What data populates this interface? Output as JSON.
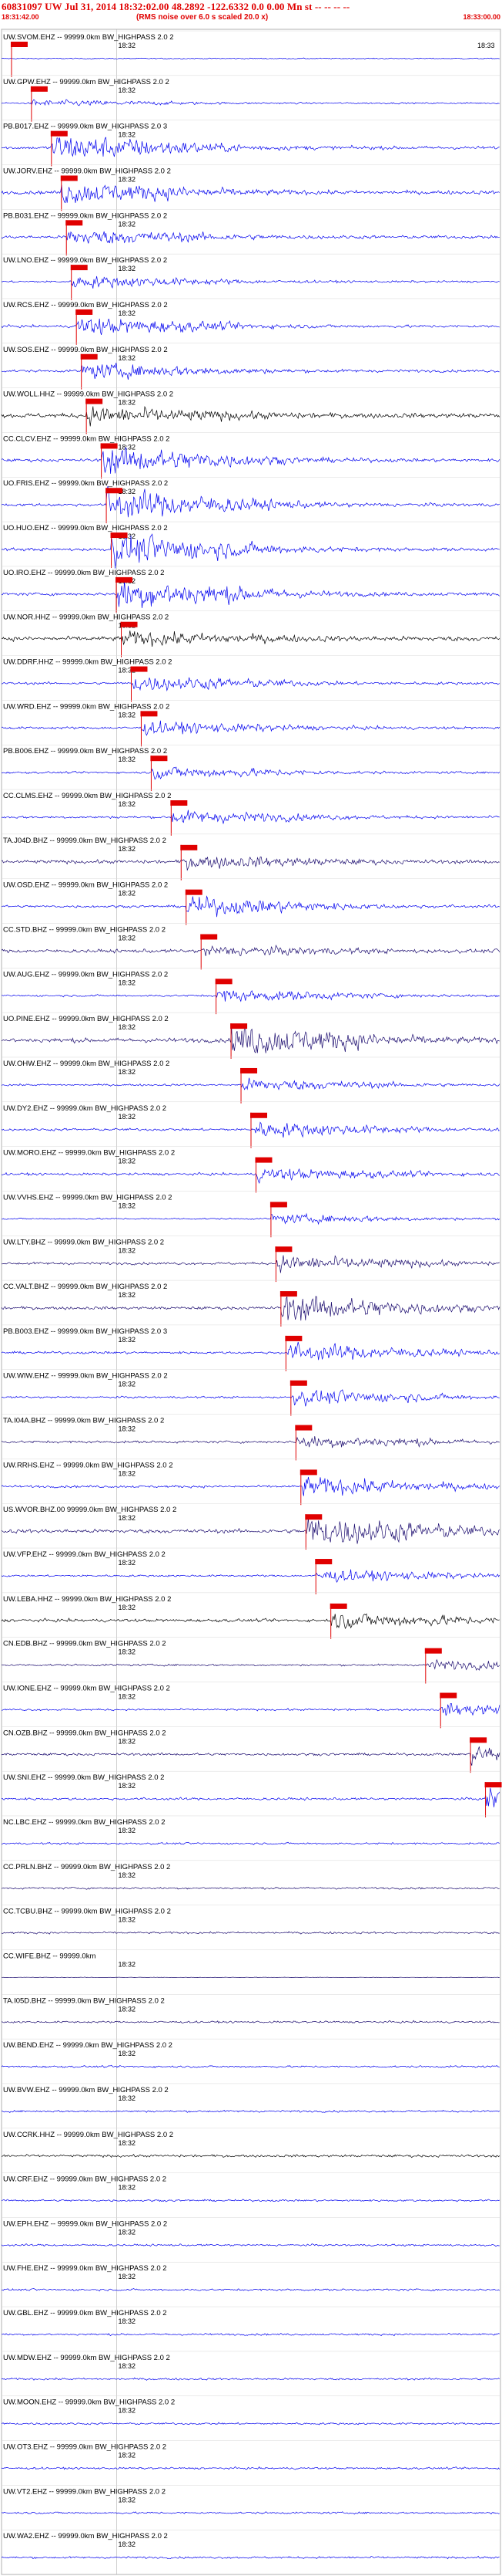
{
  "header": {
    "title": "60831097 UW Jul 31, 2014 18:32:02.00   48.2892 -122.6332   0.0 0.00 Mn st -- -- -- --",
    "subtitle": "(RMS noise over 6.0 s scaled 20.0 x)",
    "start_time": "18:31:42.00",
    "end_time": "18:33:00.00"
  },
  "colors": {
    "title": "#e00000",
    "pick": "#e00000",
    "trace_blue": "#0000ee",
    "trace_black": "#000000",
    "trace_navy": "#1a0a6e",
    "grid": "#b0b0b0"
  },
  "chart_data": {
    "type": "line",
    "title": "60831097 UW Jul 31, 2014 18:32:02.00   48.2892 -122.6332   0.0 0.00 Mn st -- -- -- --",
    "xlabel": "",
    "ylabel": "",
    "x_range": [
      "18:31:42.00",
      "18:33:00.00"
    ],
    "grid": true,
    "legend": "none",
    "time_tick_labels": [
      "18:32",
      "18:33"
    ],
    "traces": [
      {
        "label": "UW.SVOM.EHZ -- 99999.0km BW_HIGHPASS 2.0 2",
        "pick": 0.02,
        "amp": 0.1,
        "burst": 0.0,
        "color": "blue"
      },
      {
        "label": "UW.GPW.EHZ -- 99999.0km BW_HIGHPASS 2.0 2",
        "pick": 0.06,
        "amp": 0.15,
        "burst": 0.2,
        "color": "blue"
      },
      {
        "label": "PB.B017.EHZ -- 99999.0km BW_HIGHPASS 2.0 3",
        "pick": 0.1,
        "amp": 0.3,
        "burst": 0.9,
        "color": "blue"
      },
      {
        "label": "UW.JORV.EHZ -- 99999.0km BW_HIGHPASS 2.0 2",
        "pick": 0.12,
        "amp": 0.35,
        "burst": 0.7,
        "color": "blue"
      },
      {
        "label": "PB.B031.EHZ -- 99999.0km BW_HIGHPASS 2.0 2",
        "pick": 0.13,
        "amp": 0.3,
        "burst": 0.5,
        "color": "blue"
      },
      {
        "label": "UW.LNO.EHZ -- 99999.0km BW_HIGHPASS 2.0 2",
        "pick": 0.14,
        "amp": 0.2,
        "burst": 0.4,
        "color": "blue"
      },
      {
        "label": "UW.RCS.EHZ -- 99999.0km BW_HIGHPASS 2.0 2",
        "pick": 0.15,
        "amp": 0.25,
        "burst": 0.6,
        "color": "blue"
      },
      {
        "label": "UW.SOS.EHZ -- 99999.0km BW_HIGHPASS 2.0 2",
        "pick": 0.16,
        "amp": 0.25,
        "burst": 0.5,
        "color": "blue"
      },
      {
        "label": "UW.WOLL.HHZ -- 99999.0km BW_HIGHPASS 2.0 2",
        "pick": 0.17,
        "amp": 0.45,
        "burst": 0.5,
        "color": "black"
      },
      {
        "label": "CC.CLCV.EHZ -- 99999.0km BW_HIGHPASS 2.0 2",
        "pick": 0.2,
        "amp": 0.3,
        "burst": 0.9,
        "color": "blue"
      },
      {
        "label": "UO.FRIS.EHZ -- 99999.0km BW_HIGHPASS 2.0 2",
        "pick": 0.21,
        "amp": 0.3,
        "burst": 1.0,
        "color": "blue"
      },
      {
        "label": "UO.HUO.EHZ -- 99999.0km BW_HIGHPASS 2.0 2",
        "pick": 0.22,
        "amp": 0.3,
        "burst": 1.0,
        "color": "blue"
      },
      {
        "label": "UO.IRO.EHZ -- 99999.0km BW_HIGHPASS 2.0 2",
        "pick": 0.23,
        "amp": 0.3,
        "burst": 1.0,
        "color": "blue"
      },
      {
        "label": "UW.NOR.HHZ -- 99999.0km BW_HIGHPASS 2.0 2",
        "pick": 0.24,
        "amp": 0.45,
        "burst": 0.4,
        "color": "black"
      },
      {
        "label": "UW.DDRF.HHZ -- 99999.0km BW_HIGHPASS 2.0 2",
        "pick": 0.26,
        "amp": 0.25,
        "burst": 0.5,
        "color": "blue"
      },
      {
        "label": "UW.WRD.EHZ -- 99999.0km BW_HIGHPASS 2.0 2",
        "pick": 0.28,
        "amp": 0.25,
        "burst": 0.4,
        "color": "blue"
      },
      {
        "label": "PB.B006.EHZ -- 99999.0km BW_HIGHPASS 2.0 2",
        "pick": 0.3,
        "amp": 0.2,
        "burst": 0.4,
        "color": "blue"
      },
      {
        "label": "CC.CLMS.EHZ -- 99999.0km BW_HIGHPASS 2.0 2",
        "pick": 0.34,
        "amp": 0.25,
        "burst": 0.4,
        "color": "blue"
      },
      {
        "label": "TA.J04D.BHZ -- 99999.0km BW_HIGHPASS 2.0 2",
        "pick": 0.36,
        "amp": 0.35,
        "burst": 0.4,
        "color": "navy"
      },
      {
        "label": "UW.OSD.EHZ -- 99999.0km BW_HIGHPASS 2.0 2",
        "pick": 0.37,
        "amp": 0.25,
        "burst": 0.6,
        "color": "blue"
      },
      {
        "label": "CC.STD.BHZ -- 99999.0km BW_HIGHPASS 2.0 2",
        "pick": 0.4,
        "amp": 0.35,
        "burst": 0.3,
        "color": "navy"
      },
      {
        "label": "UW.AUG.EHZ -- 99999.0km BW_HIGHPASS 2.0 2",
        "pick": 0.43,
        "amp": 0.2,
        "burst": 0.4,
        "color": "blue"
      },
      {
        "label": "UO.PINE.EHZ -- 99999.0km BW_HIGHPASS 2.0 2",
        "pick": 0.46,
        "amp": 0.45,
        "burst": 1.0,
        "color": "navy"
      },
      {
        "label": "UW.OHW.EHZ -- 99999.0km BW_HIGHPASS 2.0 2",
        "pick": 0.48,
        "amp": 0.2,
        "burst": 0.4,
        "color": "blue"
      },
      {
        "label": "UW.DY2.EHZ -- 99999.0km BW_HIGHPASS 2.0 2",
        "pick": 0.5,
        "amp": 0.25,
        "burst": 0.5,
        "color": "blue"
      },
      {
        "label": "UW.MORO.EHZ -- 99999.0km BW_HIGHPASS 2.0 2",
        "pick": 0.51,
        "amp": 0.25,
        "burst": 0.4,
        "color": "blue"
      },
      {
        "label": "UW.VVHS.EHZ -- 99999.0km BW_HIGHPASS 2.0 2",
        "pick": 0.54,
        "amp": 0.15,
        "burst": 0.3,
        "color": "blue"
      },
      {
        "label": "UW.LTY.BHZ -- 99999.0km BW_HIGHPASS 2.0 2",
        "pick": 0.55,
        "amp": 0.25,
        "burst": 0.5,
        "color": "navy"
      },
      {
        "label": "CC.VALT.BHZ -- 99999.0km BW_HIGHPASS 2.0 2",
        "pick": 0.56,
        "amp": 0.3,
        "burst": 0.9,
        "color": "navy"
      },
      {
        "label": "PB.B003.EHZ -- 99999.0km BW_HIGHPASS 2.0 3",
        "pick": 0.57,
        "amp": 0.25,
        "burst": 0.6,
        "color": "blue"
      },
      {
        "label": "UW.WIW.EHZ -- 99999.0km BW_HIGHPASS 2.0 2",
        "pick": 0.58,
        "amp": 0.2,
        "burst": 0.5,
        "color": "blue"
      },
      {
        "label": "TA.I04A.BHZ -- 99999.0km BW_HIGHPASS 2.0 2",
        "pick": 0.59,
        "amp": 0.25,
        "burst": 0.4,
        "color": "navy"
      },
      {
        "label": "UW.RRHS.EHZ -- 99999.0km BW_HIGHPASS 2.0 2",
        "pick": 0.6,
        "amp": 0.25,
        "burst": 0.6,
        "color": "blue"
      },
      {
        "label": "US.WVOR.BHZ.00 99999.0km BW_HIGHPASS 2.0 2",
        "pick": 0.61,
        "amp": 0.4,
        "burst": 1.0,
        "color": "navy"
      },
      {
        "label": "UW.VFP.EHZ -- 99999.0km BW_HIGHPASS 2.0 2",
        "pick": 0.63,
        "amp": 0.2,
        "burst": 0.4,
        "color": "blue"
      },
      {
        "label": "UW.LEBA.HHZ -- 99999.0km BW_HIGHPASS 2.0 2",
        "pick": 0.66,
        "amp": 0.3,
        "burst": 0.5,
        "color": "black"
      },
      {
        "label": "CN.EDB.BHZ -- 99999.0km BW_HIGHPASS 2.0 2",
        "pick": 0.85,
        "amp": 0.2,
        "burst": 0.3,
        "color": "navy"
      },
      {
        "label": "UW.IONE.EHZ -- 99999.0km BW_HIGHPASS 2.0 2",
        "pick": 0.88,
        "amp": 0.2,
        "burst": 0.4,
        "color": "blue"
      },
      {
        "label": "CN.OZB.BHZ -- 99999.0km BW_HIGHPASS 2.0 2",
        "pick": 0.94,
        "amp": 0.25,
        "burst": 0.6,
        "color": "navy"
      },
      {
        "label": "UW.SNI.EHZ -- 99999.0km BW_HIGHPASS 2.0 2",
        "pick": 0.97,
        "amp": 0.25,
        "burst": 0.8,
        "color": "blue"
      },
      {
        "label": "NC.LBC.EHZ -- 99999.0km BW_HIGHPASS 2.0 2",
        "pick": null,
        "amp": 0.2,
        "burst": 0.0,
        "color": "blue"
      },
      {
        "label": "CC.PRLN.BHZ -- 99999.0km BW_HIGHPASS 2.0 2",
        "pick": null,
        "amp": 0.2,
        "burst": 0.0,
        "color": "navy"
      },
      {
        "label": "CC.TCBU.BHZ -- 99999.0km BW_HIGHPASS 2.0 2",
        "pick": null,
        "amp": 0.2,
        "burst": 0.0,
        "color": "navy"
      },
      {
        "label": "CC.WIFE.BHZ -- 99999.0km",
        "pick": null,
        "amp": 0.05,
        "burst": 0.0,
        "color": "navy"
      },
      {
        "label": "TA.I05D.BHZ -- 99999.0km BW_HIGHPASS 2.0 2",
        "pick": null,
        "amp": 0.2,
        "burst": 0.0,
        "color": "navy"
      },
      {
        "label": "UW.BEND.EHZ -- 99999.0km BW_HIGHPASS 2.0 2",
        "pick": null,
        "amp": 0.2,
        "burst": 0.0,
        "color": "blue"
      },
      {
        "label": "UW.BVW.EHZ -- 99999.0km BW_HIGHPASS 2.0 2",
        "pick": null,
        "amp": 0.2,
        "burst": 0.0,
        "color": "blue"
      },
      {
        "label": "UW.CCRK.HHZ -- 99999.0km BW_HIGHPASS 2.0 2",
        "pick": null,
        "amp": 0.25,
        "burst": 0.0,
        "color": "black"
      },
      {
        "label": "UW.CRF.EHZ -- 99999.0km BW_HIGHPASS 2.0 2",
        "pick": null,
        "amp": 0.2,
        "burst": 0.0,
        "color": "blue"
      },
      {
        "label": "UW.EPH.EHZ -- 99999.0km BW_HIGHPASS 2.0 2",
        "pick": null,
        "amp": 0.2,
        "burst": 0.0,
        "color": "blue"
      },
      {
        "label": "UW.FHE.EHZ -- 99999.0km BW_HIGHPASS 2.0 2",
        "pick": null,
        "amp": 0.2,
        "burst": 0.0,
        "color": "blue"
      },
      {
        "label": "UW.GBL.EHZ -- 99999.0km BW_HIGHPASS 2.0 2",
        "pick": null,
        "amp": 0.2,
        "burst": 0.0,
        "color": "blue"
      },
      {
        "label": "UW.MDW.EHZ -- 99999.0km BW_HIGHPASS 2.0 2",
        "pick": null,
        "amp": 0.2,
        "burst": 0.0,
        "color": "blue"
      },
      {
        "label": "UW.MOON.EHZ -- 99999.0km BW_HIGHPASS 2.0 2",
        "pick": null,
        "amp": 0.2,
        "burst": 0.0,
        "color": "blue"
      },
      {
        "label": "UW.OT3.EHZ -- 99999.0km BW_HIGHPASS 2.0 2",
        "pick": null,
        "amp": 0.2,
        "burst": 0.0,
        "color": "blue"
      },
      {
        "label": "UW.VT2.EHZ -- 99999.0km BW_HIGHPASS 2.0 2",
        "pick": null,
        "amp": 0.2,
        "burst": 0.0,
        "color": "blue"
      },
      {
        "label": "UW.WA2.EHZ -- 99999.0km BW_HIGHPASS 2.0 2",
        "pick": null,
        "amp": 0.2,
        "burst": 0.0,
        "color": "blue"
      }
    ]
  }
}
